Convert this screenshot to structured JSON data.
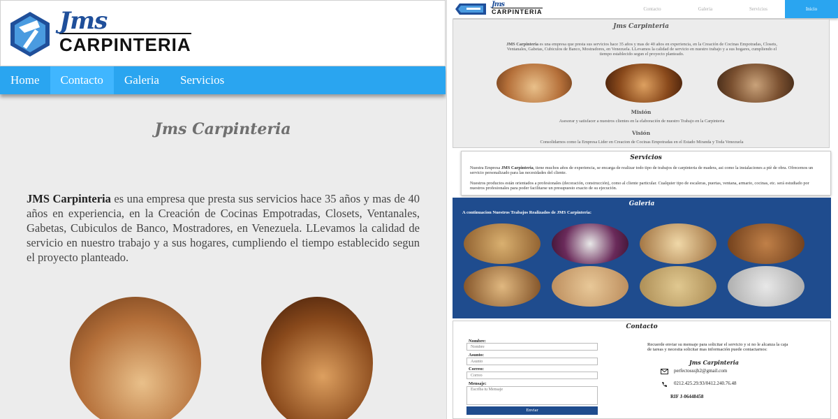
{
  "brand": {
    "script": "Jms",
    "block": "CARPINTERIA"
  },
  "nav": {
    "home": "Home",
    "contacto": "Contacto",
    "galeria": "Galeria",
    "servicios": "Servicios"
  },
  "main": {
    "title": "Jms Carpinteria",
    "intro_bold": "JMS Carpinteria",
    "intro_rest": " es una empresa que presta sus servicios hace 35 años y mas de 40 años en experiencia, en la Creación de Cocinas Empotradas, Closets, Ventanales, Gabetas, Cubiculos de Banco, Mostradores, en Venezuela. LLevamos la calidad de servicio en nuestro trabajo y a sus hogares, cumpliendo el tiempo establecido segun el proyecto planteado."
  },
  "desktop": {
    "nav": {
      "contacto": "Contacto",
      "galeria": "Galeria",
      "servicios": "Servicios",
      "inicio": "Inicio"
    },
    "mision_title": "Misión",
    "mision_text": "Asesorar y satisfacer a nuestros clientes en la elaboración de nuestro Trabajo en la Carpinteria",
    "vision_title": "Visión",
    "vision_text": "Consolidarnos como la Empresa Lider en Creacion de Cocinas Empotradas en el Estado Miranda y Toda Venezuela",
    "servicios_title": "Servicios",
    "servicios_p1_a": "Nuestra Empresa ",
    "servicios_p1_b": "JMS Carpinteria",
    "servicios_p1_c": ", tiene muchos años de experiencia, se encarga de realizar todo tipo de trabajos de carpinteria de madera, asi como la instalaciones a piè de obra. Ofrecemos un servicio personalizado para las necesidades del cliente.",
    "servicios_p2": "Nuestros productos están orientados a profesionales (decoración, construcción), como al cliente particular. Cualquier tipo de escaleras, puertas, ventana, armario, cocinas, etc. será estudiado por nuestros profesionales para poder facilitarse un presupuesto exacto de su ejecución.",
    "galeria_title": "Galeria",
    "galeria_sub": "A continuacion Nuestros Trabajos Realizados de JMS Carpinteria:",
    "contacto_title": "Contacto",
    "form": {
      "nombre_label": "Nombre:",
      "nombre_ph": "Nombre",
      "asunto_label": "Asunto:",
      "asunto_ph": "Asunto",
      "correo_label": "Correo:",
      "correo_ph": "Correo",
      "mensaje_label": "Mensaje:",
      "mensaje_ph": "Escriba tu Mensaje",
      "send": "Enviar"
    },
    "contact_note": "Recuerde enviar su mensaje para solicitar el servicio y si no le alcanza la caja de tareas y necesita solicitar mas información puede contactarnos:",
    "contact_brand": "Jms Carpinteria",
    "email": "perfectosssjh2@gmail.com",
    "phone": "0212.425.29.93/0412.240.76.48",
    "rif": "RIF J-06448458"
  },
  "colors": {
    "nav": "#2aa5f0",
    "galeria_bg": "#1f4c8e"
  }
}
